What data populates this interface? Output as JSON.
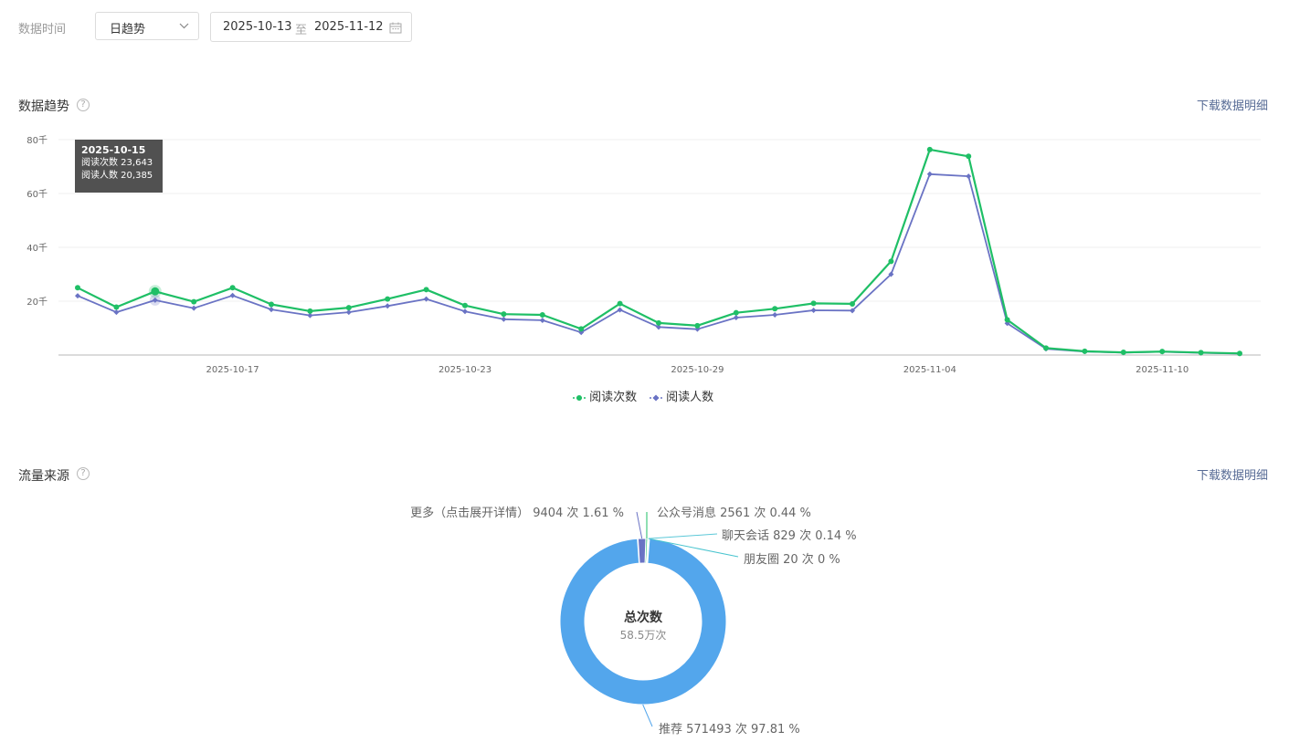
{
  "filter": {
    "label": "数据时间",
    "granularity": "日趋势",
    "start_date": "2025-10-13",
    "separator": "至",
    "end_date": "2025-11-12"
  },
  "trend": {
    "title": "数据趋势",
    "help": "?",
    "download": "下载数据明细",
    "tooltip": {
      "date": "2025-10-15",
      "line1": "阅读次数 23,643",
      "line2": "阅读人数 20,385"
    }
  },
  "source": {
    "title": "流量来源",
    "help": "?",
    "download": "下载数据明细",
    "center_title": "总次数",
    "center_value": "58.5万次",
    "labels": {
      "more": "更多（点击展开详情） 9404 次 1.61 %",
      "official": "公众号消息 2561 次 0.44 %",
      "chat": "聊天会话 829 次 0.14 %",
      "moments": "朋友圈 20 次 0 %",
      "recommend": "推荐 571493 次 97.81 %"
    }
  },
  "colors": {
    "reads": "#1fbf66",
    "readers": "#6a73c4",
    "recommend": "#53a6ec",
    "more": "#6a73c4",
    "official": "#1fbf66",
    "chat": "#5cc8d8",
    "moments": "#49c4cf"
  },
  "chart_data": [
    {
      "type": "line",
      "title": "",
      "x": [
        "2025-10-13",
        "2025-10-14",
        "2025-10-15",
        "2025-10-16",
        "2025-10-17",
        "2025-10-18",
        "2025-10-19",
        "2025-10-20",
        "2025-10-21",
        "2025-10-22",
        "2025-10-23",
        "2025-10-24",
        "2025-10-25",
        "2025-10-26",
        "2025-10-27",
        "2025-10-28",
        "2025-10-29",
        "2025-10-30",
        "2025-10-31",
        "2025-11-01",
        "2025-11-02",
        "2025-11-03",
        "2025-11-04",
        "2025-11-05",
        "2025-11-06",
        "2025-11-07",
        "2025-11-08",
        "2025-11-09",
        "2025-11-10",
        "2025-11-11",
        "2025-11-12"
      ],
      "x_ticks": [
        "2025-10-17",
        "2025-10-23",
        "2025-10-29",
        "2025-11-04",
        "2025-11-10"
      ],
      "y_ticks": [
        "20千",
        "40千",
        "60千",
        "80千"
      ],
      "ylim": [
        0,
        80000
      ],
      "series": [
        {
          "name": "阅读次数",
          "values": [
            25000,
            17800,
            23643,
            19800,
            25000,
            18800,
            16300,
            17600,
            20800,
            24300,
            18400,
            15200,
            14900,
            9700,
            19100,
            11900,
            10900,
            15700,
            17200,
            19200,
            19000,
            34800,
            76300,
            73800,
            13100,
            2600,
            1400,
            1000,
            1300,
            900,
            600
          ]
        },
        {
          "name": "阅读人数",
          "values": [
            22000,
            15900,
            20385,
            17400,
            22100,
            16900,
            14700,
            15900,
            18200,
            20800,
            16200,
            13300,
            12900,
            8400,
            16800,
            10400,
            9600,
            13900,
            14900,
            16600,
            16500,
            30000,
            67200,
            66400,
            11800,
            2300,
            1300,
            900,
            1200,
            800,
            500
          ]
        }
      ],
      "legend": "bottom-center",
      "grid": true
    },
    {
      "type": "pie",
      "title": "",
      "categories": [
        "推荐",
        "更多（点击展开详情）",
        "公众号消息",
        "聊天会话",
        "朋友圈"
      ],
      "values": [
        571493,
        9404,
        2561,
        829,
        20
      ],
      "percents": [
        97.81,
        1.61,
        0.44,
        0.14,
        0
      ]
    }
  ]
}
